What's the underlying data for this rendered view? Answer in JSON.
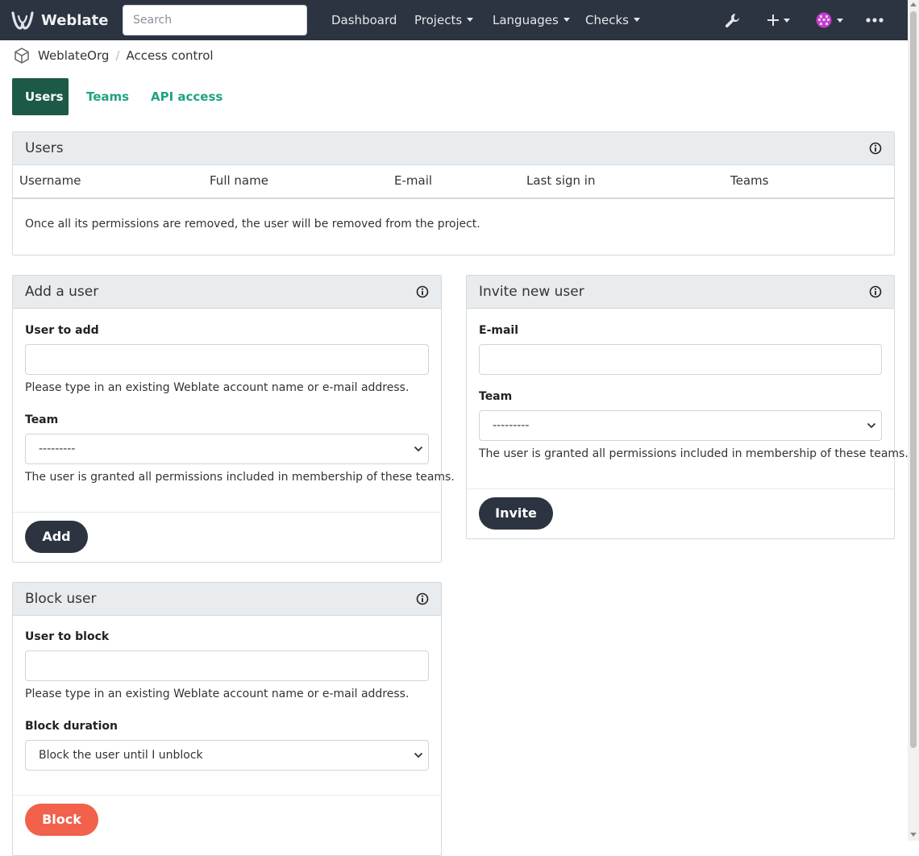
{
  "navbar": {
    "brand": "Weblate",
    "search_placeholder": "Search",
    "links": {
      "dashboard": "Dashboard",
      "projects": "Projects",
      "languages": "Languages",
      "checks": "Checks"
    },
    "icons": [
      "wrench-icon",
      "plus-icon",
      "avatar",
      "more-icon"
    ]
  },
  "breadcrumb": {
    "org": "WeblateOrg",
    "separator": "/",
    "page": "Access control"
  },
  "tabs": {
    "users": "Users",
    "teams": "Teams",
    "api": "API access"
  },
  "users_panel": {
    "title": "Users",
    "columns": [
      "Username",
      "Full name",
      "E-mail",
      "Last sign in",
      "Teams"
    ],
    "note": "Once all its permissions are removed, the user will be removed from the project."
  },
  "add_user": {
    "title": "Add a user",
    "user_label": "User to add",
    "user_value": "",
    "user_help": "Please type in an existing Weblate account name or e-mail address.",
    "team_label": "Team",
    "team_value": "---------",
    "team_help": "The user is granted all permissions included in membership of these teams.",
    "button": "Add"
  },
  "invite_user": {
    "title": "Invite new user",
    "email_label": "E-mail",
    "email_value": "",
    "team_label": "Team",
    "team_value": "---------",
    "team_help": "The user is granted all permissions included in membership of these teams.",
    "button": "Invite"
  },
  "block_user": {
    "title": "Block user",
    "user_label": "User to block",
    "user_value": "",
    "user_help": "Please type in an existing Weblate account name or e-mail address.",
    "duration_label": "Block duration",
    "duration_value": "Block the user until I unblock",
    "button": "Block"
  },
  "colors": {
    "navbar": "#2b3440",
    "tab_active": "#1c5949",
    "link": "#1fa385",
    "button": "#2b3440",
    "danger": "#f1614b"
  }
}
